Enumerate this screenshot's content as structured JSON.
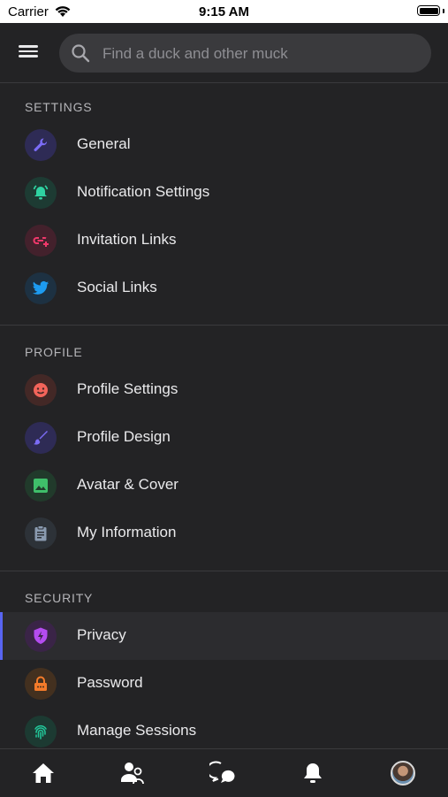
{
  "status_bar": {
    "carrier": "Carrier",
    "time": "9:15 AM"
  },
  "search": {
    "placeholder": "Find a duck and other muck"
  },
  "sections": [
    {
      "title": "SETTINGS",
      "items": [
        {
          "label": "General",
          "icon": "wrench-icon",
          "color": "#7b6cf6"
        },
        {
          "label": "Notification Settings",
          "icon": "bell-icon",
          "color": "#2fd3a2"
        },
        {
          "label": "Invitation Links",
          "icon": "link-plus-icon",
          "color": "#f0386b"
        },
        {
          "label": "Social Links",
          "icon": "twitter-icon",
          "color": "#1d9bf0"
        }
      ]
    },
    {
      "title": "PROFILE",
      "items": [
        {
          "label": "Profile Settings",
          "icon": "face-icon",
          "color": "#f2645a"
        },
        {
          "label": "Profile Design",
          "icon": "brush-icon",
          "color": "#7b6cf6"
        },
        {
          "label": "Avatar & Cover",
          "icon": "image-icon",
          "color": "#3fbf6a"
        },
        {
          "label": "My Information",
          "icon": "clipboard-icon",
          "color": "#8a9bb0"
        }
      ]
    },
    {
      "title": "SECURITY",
      "items": [
        {
          "label": "Privacy",
          "icon": "shield-bolt-icon",
          "color": "#b44cf0",
          "active": true
        },
        {
          "label": "Password",
          "icon": "lock-icon",
          "color": "#f47b2a"
        },
        {
          "label": "Manage Sessions",
          "icon": "fingerprint-icon",
          "color": "#22c79a"
        }
      ]
    }
  ],
  "bottom_nav": [
    {
      "name": "home",
      "icon": "home-icon"
    },
    {
      "name": "friends",
      "icon": "users-icon"
    },
    {
      "name": "messages",
      "icon": "chat-icon"
    },
    {
      "name": "notifications",
      "icon": "bell-icon"
    },
    {
      "name": "profile",
      "icon": "avatar"
    }
  ],
  "colors": {
    "background": "#232325",
    "accent": "#5865f2",
    "search_bg": "#3a3a3d"
  }
}
